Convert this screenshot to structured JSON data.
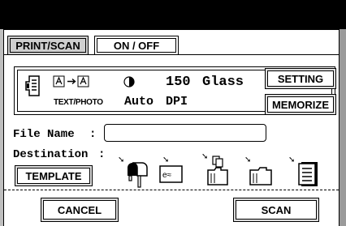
{
  "tabs": [
    {
      "label": "PRINT/SCAN",
      "active": true
    },
    {
      "label": "ON / OFF",
      "active": false
    }
  ],
  "settings": {
    "mode_label": "TEXT/PHOTO",
    "exposure_value": "Auto",
    "resolution_number": "150",
    "resolution_unit": "DPI",
    "original_type": "Glass"
  },
  "buttons": {
    "setting": "SETTING",
    "memorize": "MEMORIZE",
    "template": "TEMPLATE",
    "cancel": "CANCEL",
    "scan": "SCAN"
  },
  "file_name": {
    "label": "File Name",
    "value": ""
  },
  "destination": {
    "label": "Destination"
  },
  "destination_icons": [
    "mailbox-icon",
    "email-icon",
    "multi-folder-icon",
    "folder-icon",
    "file-icon"
  ]
}
